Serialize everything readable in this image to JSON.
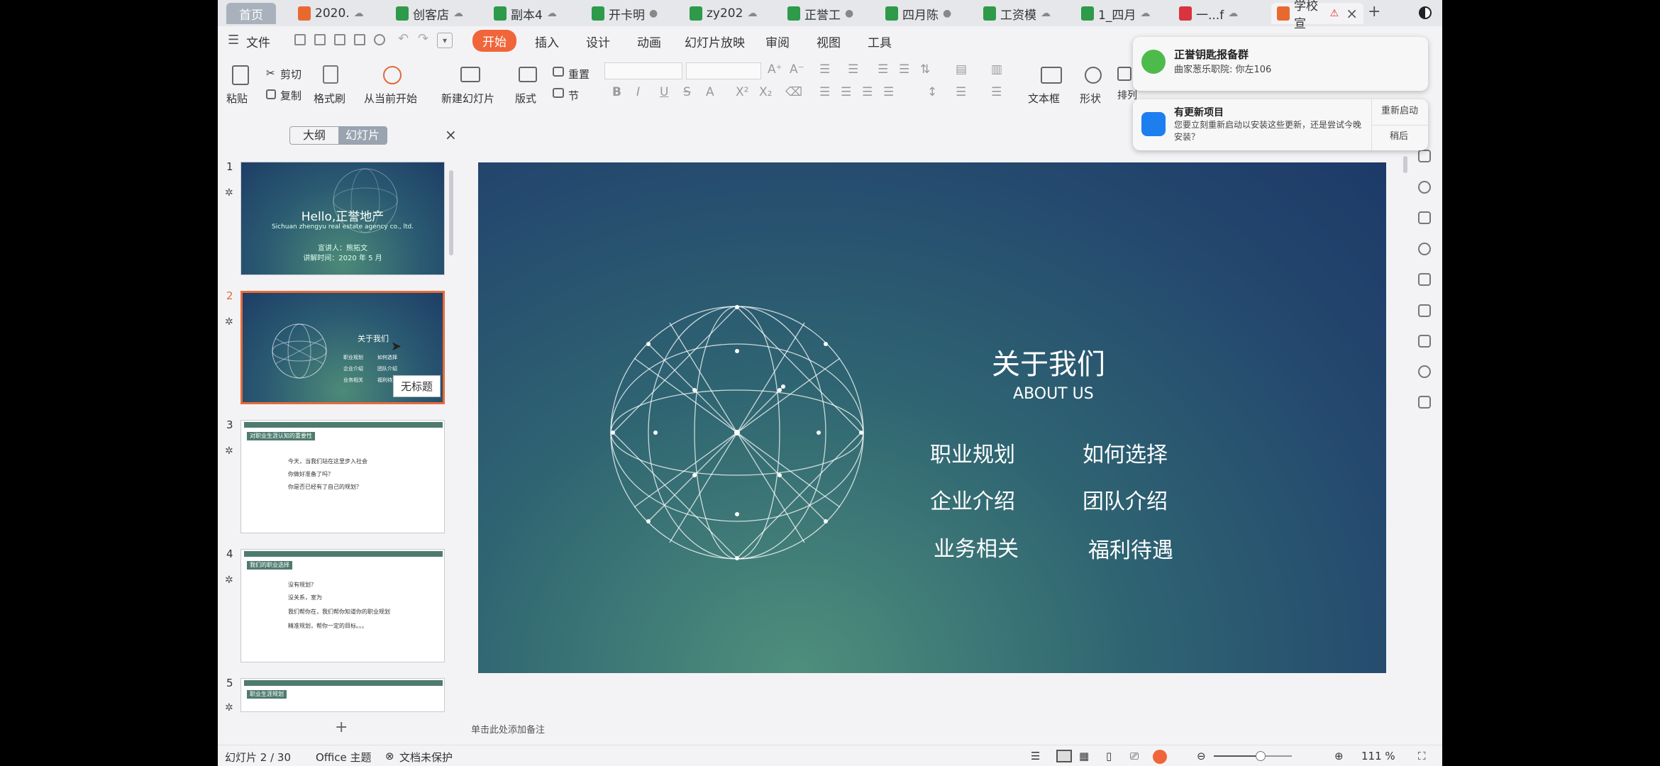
{
  "tabs": [
    {
      "label": "首页",
      "type": "home",
      "color": "#a9b1bd"
    },
    {
      "label": "2020.",
      "type": "ppt",
      "color": "#e8692f"
    },
    {
      "label": "创客店",
      "type": "sheet",
      "color": "#2e9a4a"
    },
    {
      "label": "副本4",
      "type": "sheet",
      "color": "#2e9a4a"
    },
    {
      "label": "开卡明",
      "type": "sheet",
      "color": "#2e9a4a"
    },
    {
      "label": "zy202",
      "type": "sheet",
      "color": "#2e9a4a"
    },
    {
      "label": "正誉工",
      "type": "sheet",
      "color": "#2e9a4a"
    },
    {
      "label": "四月陈",
      "type": "sheet",
      "color": "#2e9a4a"
    },
    {
      "label": "工资模",
      "type": "sheet",
      "color": "#2e9a4a"
    },
    {
      "label": "1_四月",
      "type": "sheet",
      "color": "#2e9a4a"
    },
    {
      "label": "一...f",
      "type": "pdf",
      "color": "#d9333f"
    },
    {
      "label": "学校宣",
      "type": "ppt",
      "color": "#e8692f"
    }
  ],
  "menu": {
    "file": "文件",
    "items": [
      "开始",
      "插入",
      "设计",
      "动画",
      "幻灯片放映",
      "审阅",
      "视图",
      "工具"
    ],
    "active": "开始"
  },
  "ribbon": {
    "paste": "粘贴",
    "cut": "剪切",
    "copy": "复制",
    "format_painter": "格式刷",
    "play_from_current": "从当前开始",
    "new_slide": "新建幻灯片",
    "layout": "版式",
    "reset": "重置",
    "section": "节",
    "textbox": "文本框",
    "shape": "形状",
    "arrange": "排列"
  },
  "left_panel": {
    "tab_outline": "大纲",
    "tab_slides": "幻灯片",
    "slides": [
      {
        "num": "1",
        "title": "Hello,正誉地产",
        "subtitle": "Sichuan zhengyu real estate agency co., ltd.",
        "presenter": "宣讲人：熊拓文",
        "time": "讲解时间：2020 年 5 月"
      },
      {
        "num": "2",
        "title": "关于我们",
        "items": [
          "职业规划",
          "如何选择",
          "企业介绍",
          "团队介绍",
          "业务相关",
          "福利待遇"
        ]
      },
      {
        "num": "3",
        "band": "对职业生涯认知的重要性",
        "lines": [
          "今天，当我们站在这里步入社会",
          "你做好准备了吗？",
          "你是否已经有了自己的规划？"
        ]
      },
      {
        "num": "4",
        "band": "我们的职业选择",
        "lines": [
          "没有规划？",
          "没关系，室为",
          "我们帮你在，我们帮你知道你的职业规划",
          "精准规划，帮你一定的目标。。。"
        ]
      },
      {
        "num": "5",
        "band": "职业生涯规划"
      }
    ],
    "tooltip": "无标题",
    "add": "+"
  },
  "slide": {
    "title": "关于我们",
    "subtitle": "ABOUT US",
    "items": [
      "职业规划",
      "如何选择",
      "企业介绍",
      "团队介绍",
      "业务相关",
      "福利待遇"
    ]
  },
  "notes_placeholder": "单击此处添加备注",
  "notifications": [
    {
      "title": "正誉钥匙报备群",
      "text": "曲家葱乐职院: 你左106"
    },
    {
      "title": "有更新项目",
      "text": "您要立刻重新启动以安装这些更新，还是尝试今晚安装？",
      "action1": "重新启动",
      "action2": "稍后"
    }
  ],
  "status": {
    "slide_info": "幻灯片 2 / 30",
    "theme": "Office 主题",
    "protection": "文档未保护",
    "zoom": "111 %",
    "zoom_level": 0.6
  }
}
